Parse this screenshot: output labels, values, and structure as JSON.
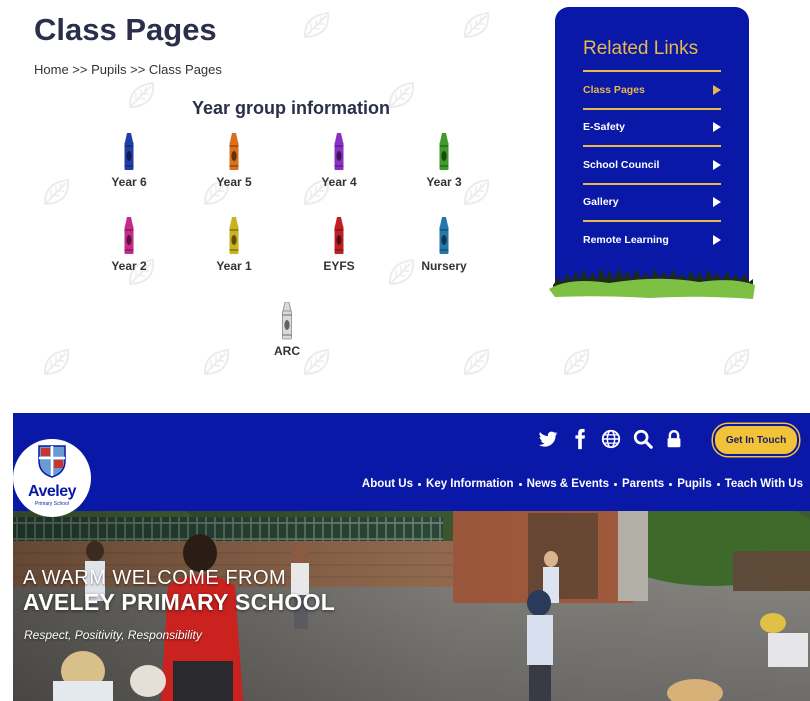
{
  "class_pages": {
    "title": "Class Pages",
    "breadcrumb": "Home >> Pupils >> Class Pages",
    "section_heading": "Year group information",
    "crayons": [
      {
        "label": "Year 6",
        "color": "#1f3fa8"
      },
      {
        "label": "Year 5",
        "color": "#d8701c"
      },
      {
        "label": "Year 4",
        "color": "#8a2fc4"
      },
      {
        "label": "Year 3",
        "color": "#3f9c2c"
      },
      {
        "label": "Year 2",
        "color": "#c62a8a"
      },
      {
        "label": "Year 1",
        "color": "#c9b21e"
      },
      {
        "label": "EYFS",
        "color": "#c01f24"
      },
      {
        "label": "Nursery",
        "color": "#2477a8"
      },
      {
        "label": "ARC",
        "color": "#d9d9d9"
      }
    ]
  },
  "related_links": {
    "title": "Related Links",
    "items": [
      {
        "label": "Class Pages",
        "active": true
      },
      {
        "label": "E-Safety",
        "active": false
      },
      {
        "label": "School Council",
        "active": false
      },
      {
        "label": "Gallery",
        "active": false
      },
      {
        "label": "Remote Learning",
        "active": false
      }
    ]
  },
  "site": {
    "logo_name": "Aveley",
    "logo_sub": "Primary School",
    "icons": [
      "twitter-icon",
      "facebook-icon",
      "globe-icon",
      "search-icon",
      "lock-icon"
    ],
    "cta_label": "Get In Touch",
    "nav": [
      "About Us",
      "Key Information",
      "News & Events",
      "Parents",
      "Pupils",
      "Teach With Us"
    ],
    "hero_line1": "A WARM WELCOME FROM",
    "hero_line2": "AVELEY PRIMARY SCHOOL",
    "hero_tagline": "Respect, Positivity, Responsibility"
  },
  "colors": {
    "brand_blue": "#0a18a8",
    "accent_gold": "#e8b84a",
    "cta_yellow": "#f2c238"
  }
}
